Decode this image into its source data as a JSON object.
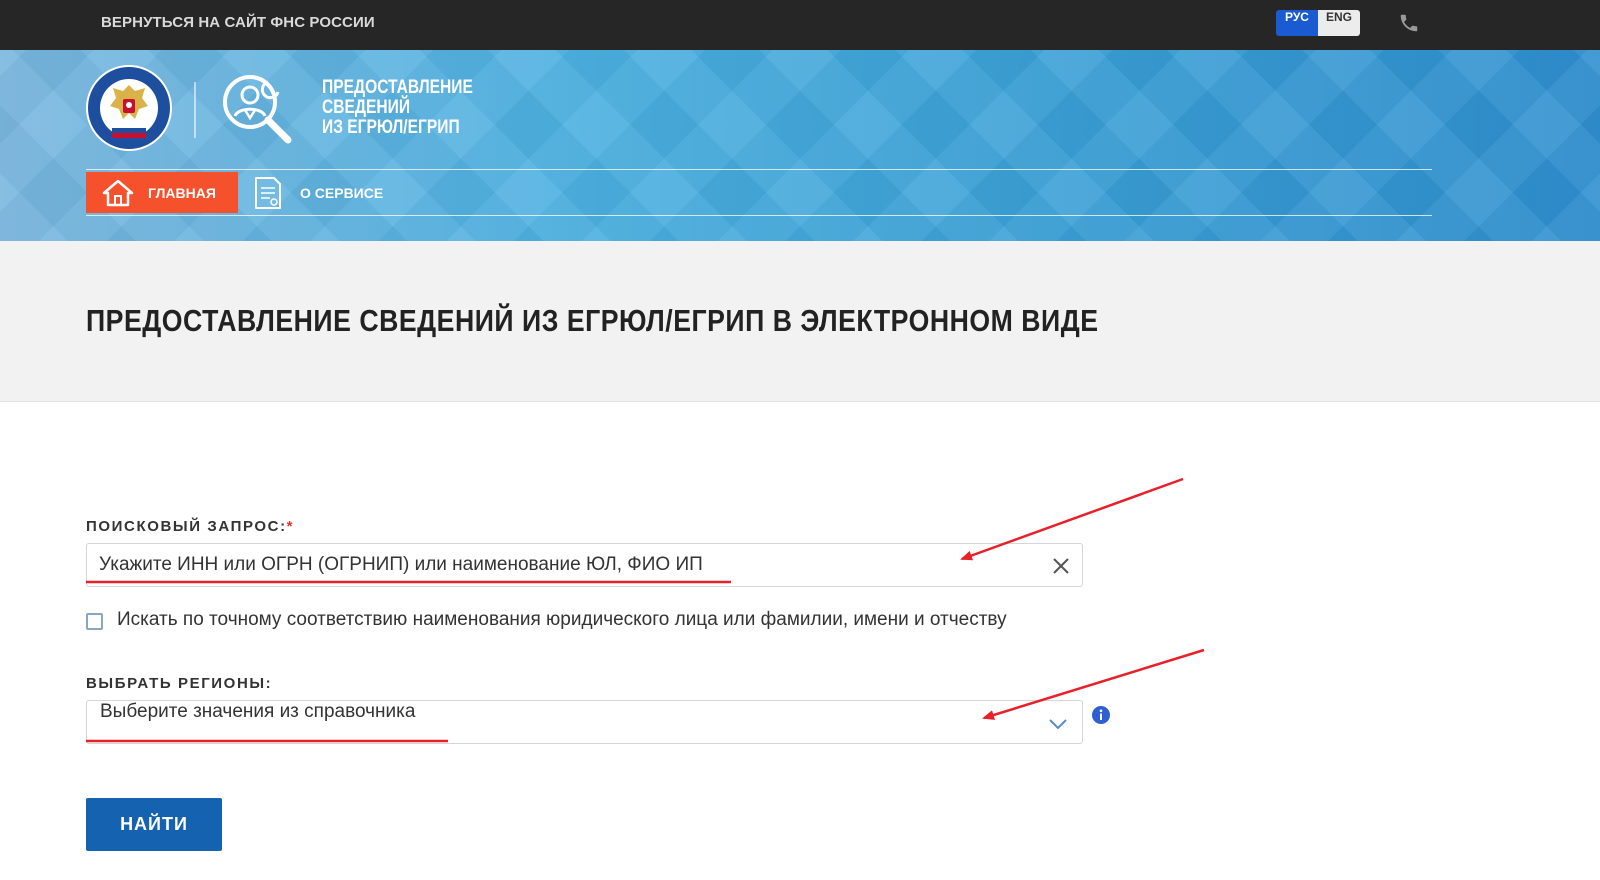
{
  "topbar": {
    "back_link": "ВЕРНУТЬСЯ НА САЙТ ФНС РОССИИ",
    "languages": [
      {
        "label": "РУС",
        "active": true
      },
      {
        "label": "ENG",
        "active": false
      }
    ],
    "phone_icon": "phone-icon"
  },
  "header": {
    "service_title_lines": [
      "ПРЕДОСТАВЛЕНИЕ",
      "СВЕДЕНИЙ",
      "ИЗ ЕГРЮЛ/ЕГРИП"
    ],
    "nav": [
      {
        "label": "ГЛАВНАЯ",
        "icon": "home-icon",
        "active": true
      },
      {
        "label": "О СЕРВИСЕ",
        "icon": "document-icon",
        "active": false
      }
    ]
  },
  "page": {
    "title": "ПРЕДОСТАВЛЕНИЕ СВЕДЕНИЙ ИЗ ЕГРЮЛ/ЕГРИП В ЭЛЕКТРОННОМ ВИДЕ"
  },
  "form": {
    "search_label": "ПОИСКОВЫЙ ЗАПРОС:",
    "required_mark": "*",
    "search_placeholder": "Укажите ИНН или ОГРН (ОГРНИП) или наименование ЮЛ, ФИО ИП",
    "search_value": "",
    "exact_match_label": "Искать по точному соответствию наименования юридического лица или фамилии, имени и отчеству",
    "exact_match_checked": false,
    "regions_label": "ВЫБРАТЬ РЕГИОНЫ:",
    "regions_placeholder": "Выберите значения из справочника",
    "submit_label": "НАЙТИ"
  },
  "colors": {
    "topbar": "#262626",
    "accent_orange": "#f4512c",
    "primary_blue": "#1462b0",
    "lang_active": "#1a5bd1",
    "annotation_red": "#e8202a"
  }
}
